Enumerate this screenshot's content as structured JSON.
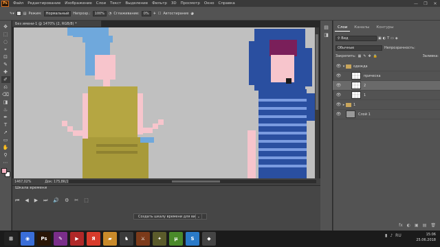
{
  "menu": {
    "logo": "Ps",
    "items": [
      "Файл",
      "Редактирование",
      "Изображение",
      "Слои",
      "Текст",
      "Выделение",
      "Фильтр",
      "3D",
      "Просмотр",
      "Окно",
      "Справка"
    ],
    "window_controls": [
      "—",
      "❐",
      "✕"
    ]
  },
  "options": {
    "mode_label": "Режим:",
    "mode_value": "Нормальный",
    "opacity_label": "Непрозр.:",
    "opacity_value": "100%",
    "flow_label": "Сглаживание:",
    "flow_value": "0%",
    "auto_erase": "Автостирание"
  },
  "tools": [
    "✥",
    "⬚",
    "◌",
    "⌖",
    "⊡",
    "✎",
    "✚",
    "✐",
    "⎌",
    "⌫",
    "◨",
    "♨",
    "✒",
    "T",
    "➚",
    "▭",
    "✋",
    "⚲",
    "⋯"
  ],
  "document": {
    "tab_title": "Без имени-1 @ 1470% (2, RGB/8) *",
    "zoom_status": "1467,02%",
    "doc_status": "Док: 175,8K/2,40M",
    "canvas_bg": "#c0c0c0"
  },
  "timeline": {
    "title": "Шкала времени",
    "controls": [
      "⏮",
      "◀",
      "▶",
      "⏭",
      "🔊",
      "⚙",
      "✂",
      "⬚"
    ],
    "create_button": "Создать шкалу времени для видео",
    "create_arrow": "⌄"
  },
  "panel": {
    "tabs": [
      "Слои",
      "Каналы",
      "Контуры"
    ],
    "active_tab": 0,
    "filter_label": "Вид",
    "blend_mode": "Обычные",
    "opacity_label": "Непрозрачность:",
    "lock_label": "Закрепить:",
    "fill_label": "Заливка:",
    "layers": [
      {
        "name": "одежда",
        "type": "group",
        "visible": true,
        "selected": false
      },
      {
        "name": "прическа",
        "type": "layer",
        "visible": true,
        "selected": false
      },
      {
        "name": "2",
        "type": "layer",
        "visible": true,
        "selected": true
      },
      {
        "name": "1",
        "type": "layer",
        "visible": true,
        "selected": false
      },
      {
        "name": "1",
        "type": "group",
        "visible": true,
        "selected": false
      },
      {
        "name": "Слой 1",
        "type": "solid",
        "visible": true,
        "selected": false
      }
    ],
    "footer_icons": [
      "fx",
      "◐",
      "▣",
      "▤",
      "🗑"
    ]
  },
  "taskbar": {
    "apps": [
      {
        "icon": "chrome-icon",
        "glyph": "◉",
        "color": "#3a6ed8"
      },
      {
        "icon": "photoshop-icon",
        "glyph": "Ps",
        "color": "#2a1606"
      },
      {
        "icon": "paint-icon",
        "glyph": "✎",
        "color": "#7a2e8a"
      },
      {
        "icon": "media-icon",
        "glyph": "▶",
        "color": "#b02828"
      },
      {
        "icon": "yandex-icon",
        "glyph": "Я",
        "color": "#d83b2b"
      },
      {
        "icon": "folder-icon",
        "glyph": "▰",
        "color": "#c98a2a"
      },
      {
        "icon": "game-icon",
        "glyph": "♞",
        "color": "#3b3b3b"
      },
      {
        "icon": "game2-icon",
        "glyph": "⚔",
        "color": "#7c3a1a"
      },
      {
        "icon": "game3-icon",
        "glyph": "✦",
        "color": "#5b5b2b"
      },
      {
        "icon": "torrent-icon",
        "glyph": "µ",
        "color": "#4a8a2a"
      },
      {
        "icon": "skype-icon",
        "glyph": "S",
        "color": "#2a7ac8"
      },
      {
        "icon": "app-icon",
        "glyph": "◆",
        "color": "#444"
      }
    ],
    "lang": "RU",
    "time": "15:06",
    "date": "25.06.2018"
  },
  "colors": {
    "accent": "#d86b1a",
    "figure_hair": "#6fa8dc",
    "figure_dress": "#b5a642",
    "figure_skin": "#f7c5cc",
    "figure2_hood": "#2a4fa0",
    "figure2_hair": "#7a1f5a",
    "figure2_stripe": "#7a9be0"
  }
}
